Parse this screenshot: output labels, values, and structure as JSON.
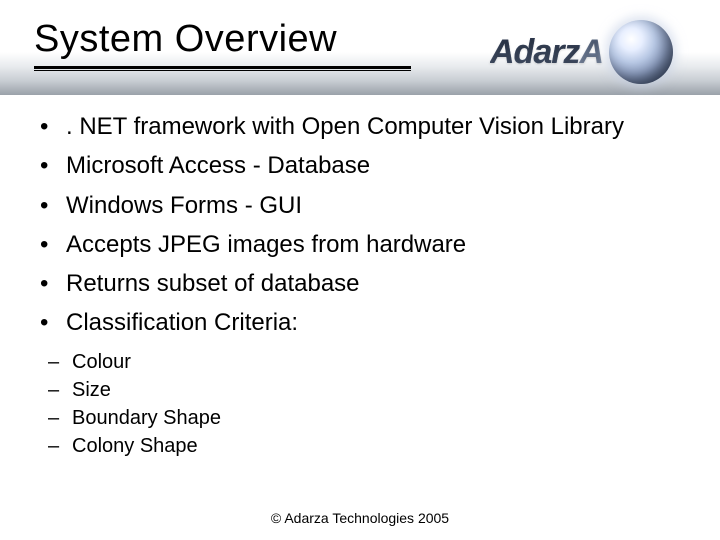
{
  "title": "System Overview",
  "logo": {
    "text_part1": "Adarz",
    "text_part2": "A"
  },
  "bullets": [
    ". NET framework with Open Computer Vision Library",
    "Microsoft Access - Database",
    "Windows Forms - GUI",
    "Accepts JPEG images from hardware",
    "Returns subset of database",
    "Classification Criteria:"
  ],
  "sub_bullets": [
    "Colour",
    "Size",
    "Boundary Shape",
    "Colony Shape"
  ],
  "footer": "© Adarza Technologies 2005"
}
